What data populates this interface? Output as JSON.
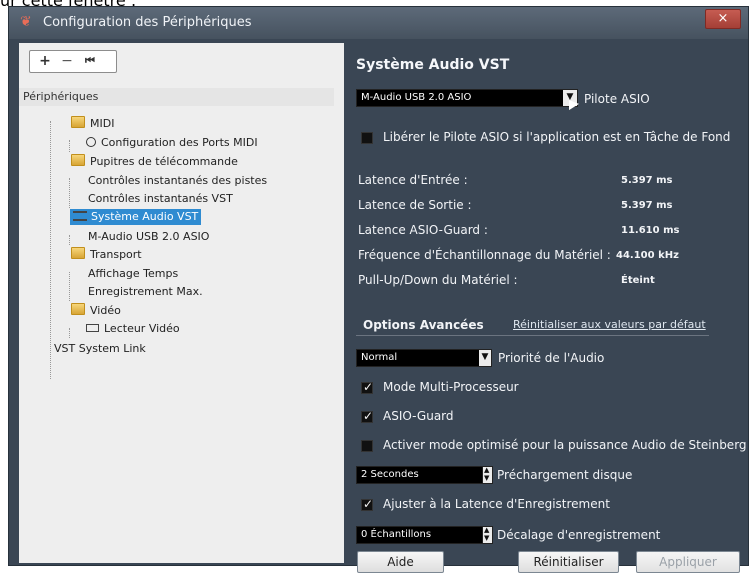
{
  "top_crop_text": "ur cette fenêtre :",
  "window": {
    "title": "Configuration des Périphériques",
    "close_icon": "close-icon"
  },
  "toolbar": {
    "add_label": "+",
    "remove_label": "−",
    "reset_label": "⏮"
  },
  "tree": {
    "header": "Périphériques",
    "items": [
      {
        "label": "MIDI",
        "icon": "folder-icon"
      },
      {
        "label": "Configuration des Ports MIDI",
        "icon": "circle-icon"
      },
      {
        "label": "Pupitres de télécommande",
        "icon": "folder-icon"
      },
      {
        "label": "Contrôles instantanés des pistes",
        "icon": ""
      },
      {
        "label": "Contrôles instantanés VST",
        "icon": ""
      },
      {
        "label": "Système Audio VST",
        "icon": "eq-icon"
      },
      {
        "label": "M-Audio USB 2.0 ASIO",
        "icon": ""
      },
      {
        "label": "Transport",
        "icon": "folder-icon"
      },
      {
        "label": "Affichage Temps",
        "icon": ""
      },
      {
        "label": "Enregistrement Max.",
        "icon": ""
      },
      {
        "label": "Vidéo",
        "icon": "folder-icon"
      },
      {
        "label": "Lecteur Vidéo",
        "icon": "video-icon"
      },
      {
        "label": "VST System Link",
        "icon": ""
      }
    ]
  },
  "audio": {
    "title": "Système Audio VST",
    "driver": "M-Audio USB 2.0 ASIO",
    "driver_label": "Pilote ASIO",
    "release_checkbox": "Libérer le Pilote ASIO si l'application est en Tâche de Fond",
    "latency_in_label": "Latence d'Entrée :",
    "latency_in_value": "5.397 ms",
    "latency_out_label": "Latence de Sortie :",
    "latency_out_value": "5.397 ms",
    "asio_guard_latency_label": "Latence ASIO-Guard :",
    "asio_guard_latency_value": "11.610 ms",
    "sample_rate_label": "Fréquence d'Échantillonnage du Matériel :",
    "sample_rate_value": "44.100 kHz",
    "pullupdown_label": "Pull-Up/Down du Matériel :",
    "pullupdown_value": "Éteint",
    "advanced_label": "Options Avancées",
    "reset_defaults_label": "Réinitialiser aux valeurs par défaut",
    "priority_value": "Normal",
    "priority_label": "Priorité de l'Audio",
    "multiprocessor_label": "Mode Multi-Processeur",
    "asio_guard_label": "ASIO-Guard",
    "steinberg_mode_label": "Activer mode optimisé pour la puissance Audio de Steinberg",
    "preload_value": "2 Secondes",
    "preload_label": "Préchargement disque",
    "adjust_latency_label": "Ajuster à la Latence d'Enregistrement",
    "offset_value": "0 Échantillons",
    "offset_label": "Décalage d'enregistrement"
  },
  "buttons": {
    "help": "Aide",
    "reset": "Réinitialiser",
    "apply": "Appliquer"
  }
}
